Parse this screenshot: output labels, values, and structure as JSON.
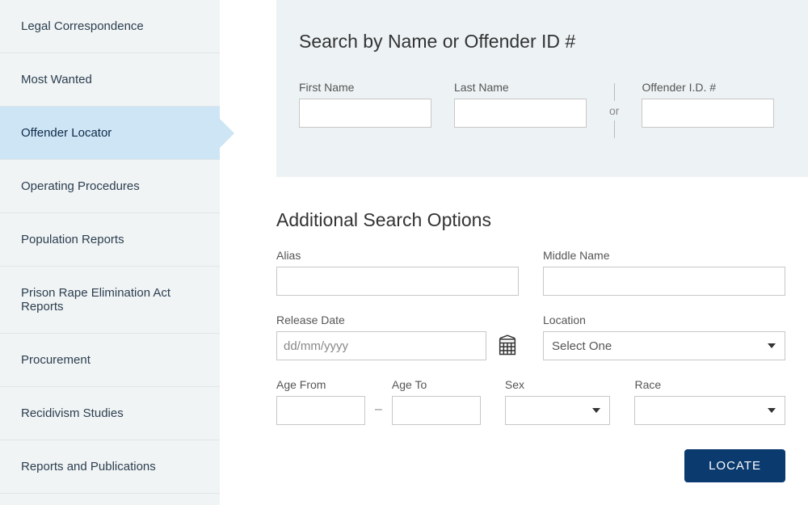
{
  "sidebar": {
    "items": [
      {
        "label": "Legal Correspondence",
        "active": false
      },
      {
        "label": "Most Wanted",
        "active": false
      },
      {
        "label": "Offender Locator",
        "active": true
      },
      {
        "label": "Operating Procedures",
        "active": false
      },
      {
        "label": "Population Reports",
        "active": false
      },
      {
        "label": "Prison Rape Elimination Act Reports",
        "active": false
      },
      {
        "label": "Procurement",
        "active": false
      },
      {
        "label": "Recidivism Studies",
        "active": false
      },
      {
        "label": "Reports and Publications",
        "active": false
      }
    ]
  },
  "search": {
    "title": "Search by Name or Offender ID #",
    "first_name_label": "First Name",
    "last_name_label": "Last Name",
    "offender_id_label": "Offender I.D. #",
    "or_text": "or"
  },
  "additional": {
    "title": "Additional Search Options",
    "alias_label": "Alias",
    "middle_name_label": "Middle Name",
    "release_date_label": "Release Date",
    "release_date_placeholder": "dd/mm/yyyy",
    "location_label": "Location",
    "location_selected": "Select One",
    "age_from_label": "Age From",
    "age_to_label": "Age To",
    "sex_label": "Sex",
    "race_label": "Race",
    "locate_button": "LOCATE"
  }
}
